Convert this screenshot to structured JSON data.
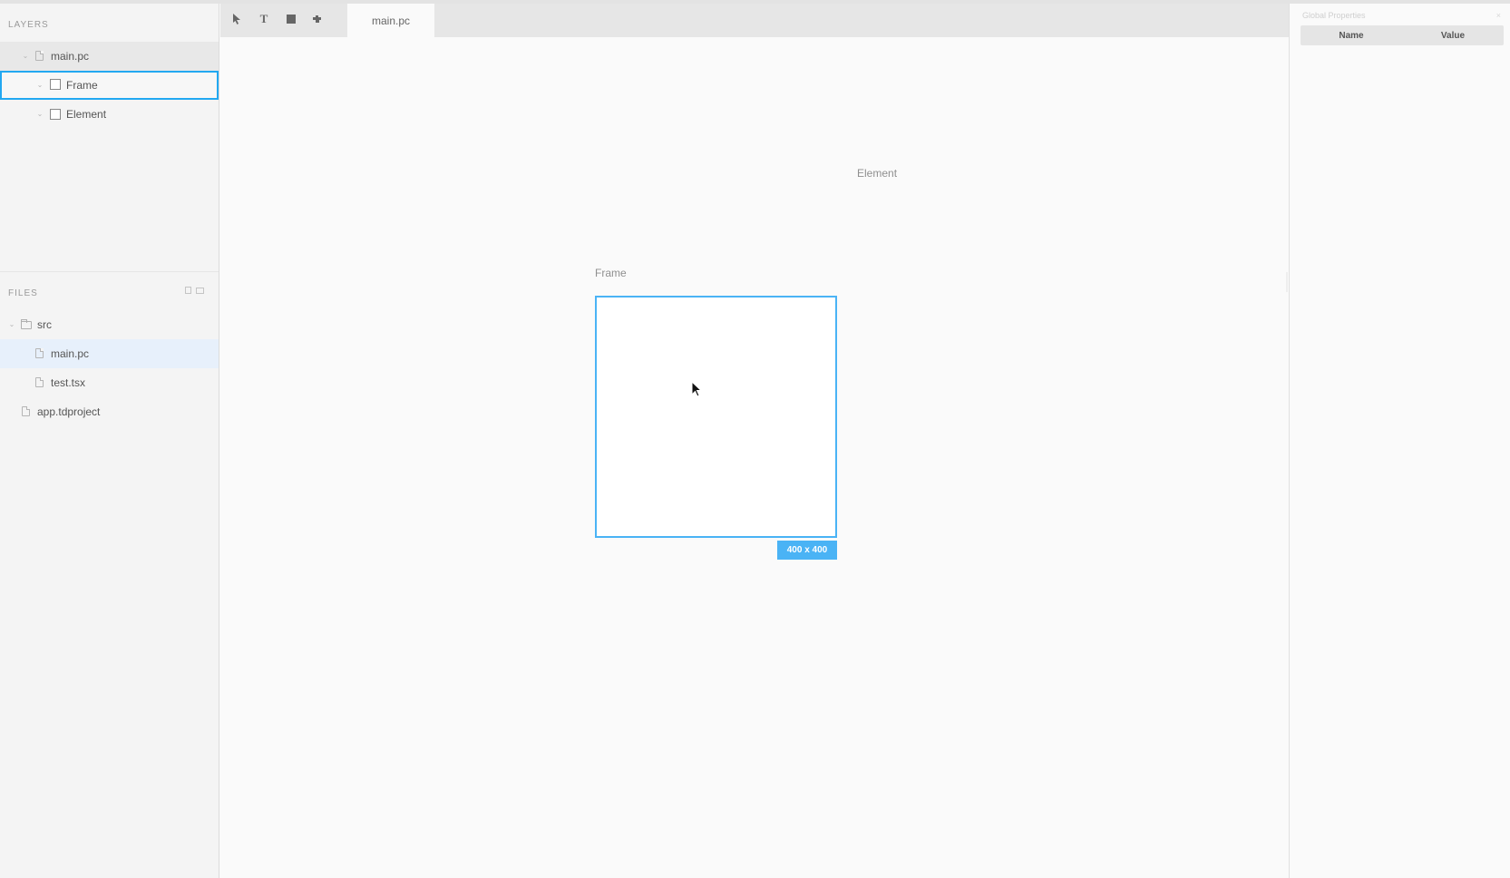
{
  "layers": {
    "heading": "LAYERS",
    "items": [
      {
        "label": "main.pc",
        "type": "file"
      },
      {
        "label": "Frame",
        "type": "element"
      },
      {
        "label": "Element",
        "type": "element"
      }
    ]
  },
  "files": {
    "heading": "FILES",
    "items": [
      {
        "label": "src",
        "type": "folder"
      },
      {
        "label": "main.pc",
        "type": "file"
      },
      {
        "label": "test.tsx",
        "type": "file"
      },
      {
        "label": "app.tdproject",
        "type": "file"
      }
    ]
  },
  "toolbar": {
    "tools": [
      "pointer-icon",
      "text-icon",
      "rectangle-icon",
      "component-icon"
    ],
    "tab_label": "main.pc"
  },
  "canvas": {
    "element_label": "Element",
    "frame_label": "Frame",
    "size_badge": "400 x 400"
  },
  "right_panel": {
    "title": "Global Properties",
    "close": "×",
    "columns": [
      "Name",
      "Value"
    ]
  },
  "colors": {
    "accent": "#4ab3f5",
    "selection": "#22a8f1",
    "active_file_bg": "#e7f0fb"
  }
}
